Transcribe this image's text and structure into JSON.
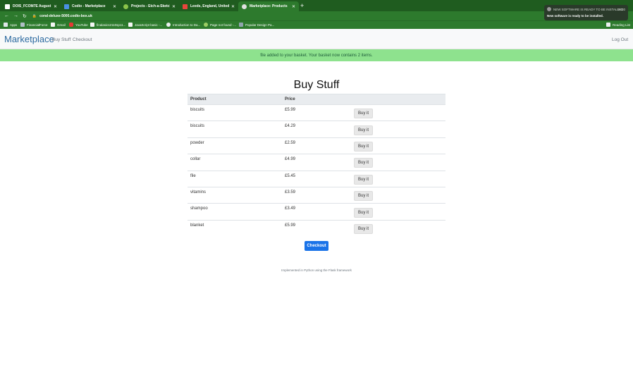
{
  "browser": {
    "tabs": [
      {
        "label": "DOIS_FCOM7E August 2021: S",
        "fav_color": "#ffffff",
        "active": false
      },
      {
        "label": "Codio - Marketplace",
        "fav_color": "#4a90e2",
        "active": false
      },
      {
        "label": "Projects - Etch-a-Sketch",
        "fav_color": "#8bc34a",
        "active": false
      },
      {
        "label": "Leeds, England, United Kingdo",
        "fav_color": "#e8453c",
        "active": false
      },
      {
        "label": "Marketplace: Products",
        "fav_color": "#e0e0e0",
        "active": true
      }
    ],
    "address": "coral-deluxe-5000.codio-box.uk",
    "bookmarks": [
      "Apps",
      "FinancialForce",
      "Gmail",
      "YouTube",
      "finalasics2110sp11...",
      "JavaScript basic -...",
      "Introduction to Da...",
      "Page not found -...",
      "Popular Design Pa...",
      "Reading List"
    ],
    "notification": {
      "title": "NEW SOFTWARE IS READY TO BE INSTALLED",
      "time": "09:20",
      "body": "New software is ready to be installed."
    }
  },
  "navbar": {
    "brand": "Marketplace",
    "links": [
      "Buy Stuff",
      "Checkout"
    ],
    "logout": "Log Out"
  },
  "alert": "file added to your basket. Your basket now contains 2 items.",
  "page": {
    "title": "Buy Stuff",
    "columns": [
      "Product",
      "Price"
    ],
    "buy_label": "Buy it",
    "products": [
      {
        "name": "biscuits",
        "price": "£5.99"
      },
      {
        "name": "biscuits",
        "price": "£4.29"
      },
      {
        "name": "powder",
        "price": "£2.59"
      },
      {
        "name": "collar",
        "price": "£4.99"
      },
      {
        "name": "file",
        "price": "£5.45"
      },
      {
        "name": "vitamins",
        "price": "£3.59"
      },
      {
        "name": "shampoo",
        "price": "£3.49"
      },
      {
        "name": "blanket",
        "price": "£5.99"
      }
    ],
    "checkout_label": "Checkout",
    "footer": "Implemented in Python using the Flask framework"
  }
}
